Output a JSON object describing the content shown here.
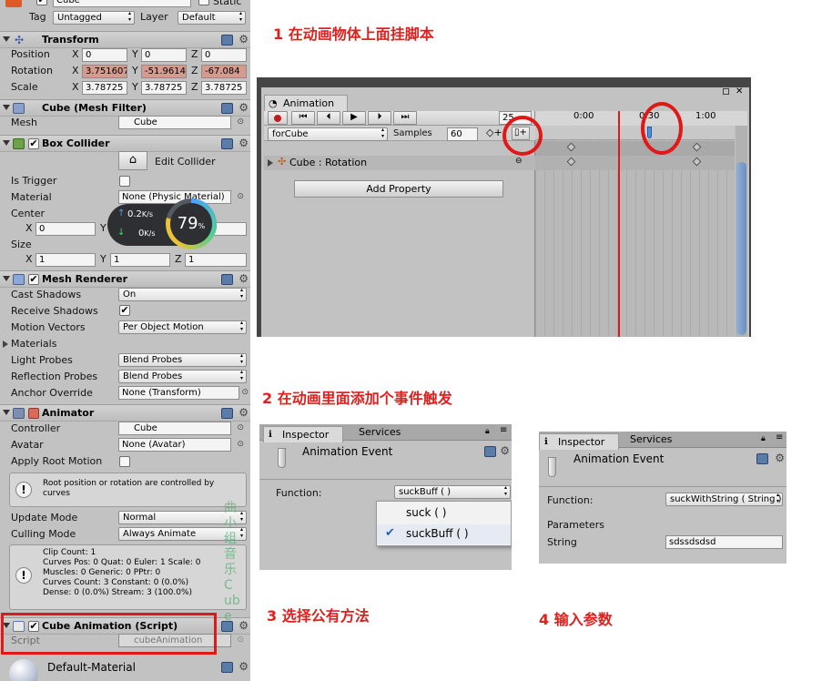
{
  "inspector": {
    "object_name": "Cube",
    "static_label": "Static",
    "tag_label": "Tag",
    "tag_value": "Untagged",
    "layer_label": "Layer",
    "layer_value": "Default",
    "transform": {
      "title": "Transform",
      "position_label": "Position",
      "rotation_label": "Rotation",
      "scale_label": "Scale",
      "position": [
        "0",
        "0",
        "0"
      ],
      "rotation": [
        "3.751607",
        "-51.9614",
        "-67.084"
      ],
      "scale": [
        "3.78725",
        "3.78725",
        "3.78725"
      ]
    },
    "mesh_filter": {
      "title": "Cube (Mesh Filter)",
      "mesh_label": "Mesh",
      "mesh_value": "Cube"
    },
    "box_collider": {
      "title": "Box Collider",
      "edit_label": "Edit Collider",
      "is_trigger_label": "Is Trigger",
      "material_label": "Material",
      "material_value": "None (Physic Material)",
      "center_label": "Center",
      "center": [
        "0",
        "0",
        "0"
      ],
      "size_label": "Size",
      "size": [
        "1",
        "1",
        "1"
      ]
    },
    "net_widget": {
      "up": "0.2",
      "up_unit": "K/s",
      "down": "0",
      "down_unit": "K/s",
      "percent": "79",
      "percent_sign": "%"
    },
    "mesh_renderer": {
      "title": "Mesh Renderer",
      "rows": [
        {
          "label": "Cast Shadows",
          "value": "On"
        },
        {
          "label": "Receive Shadows",
          "value": "✔"
        },
        {
          "label": "Motion Vectors",
          "value": "Per Object Motion"
        },
        {
          "label": "Materials",
          "value": ""
        },
        {
          "label": "Light Probes",
          "value": "Blend Probes"
        },
        {
          "label": "Reflection Probes",
          "value": "Blend Probes"
        },
        {
          "label": "Anchor Override",
          "value": "None (Transform)"
        }
      ]
    },
    "animator": {
      "title": "Animator",
      "controller_label": "Controller",
      "controller_value": "Cube",
      "avatar_label": "Avatar",
      "avatar_value": "None (Avatar)",
      "apply_root_label": "Apply Root Motion",
      "info": "Root position or rotation are controlled by curves",
      "update_label": "Update Mode",
      "update_value": "Normal",
      "culling_label": "Culling Mode",
      "culling_value": "Always Animate",
      "clip_info": [
        "Clip Count: 1",
        "Curves Pos: 0 Quat: 0 Euler: 1 Scale: 0",
        "Muscles: 0 Generic: 0 PPtr: 0",
        "Curves Count: 3 Constant: 0 (0.0%)",
        "Dense: 0 (0.0%) Stream: 3 (100.0%)"
      ]
    },
    "script_comp": {
      "title": "Cube Animation (Script)",
      "script_label": "Script",
      "script_value": "cubeAnimation"
    },
    "material": {
      "title": "Default-Material"
    },
    "watermark": "曲 小组音乐 Cube"
  },
  "steps": {
    "s1": "1 在动画物体上面挂脚本",
    "s2": "2 在动画里面添加个事件触发",
    "s3": "3 选择公有方法",
    "s4": "4 输入参数"
  },
  "animation": {
    "tab": "Animation",
    "frame": "25",
    "clip": "forCube",
    "samples_label": "Samples",
    "samples_value": "60",
    "times": [
      "0:00",
      "0:30",
      "1:00"
    ],
    "property": "Cube : Rotation",
    "add_property": "Add Property"
  },
  "event1": {
    "tab_inspector": "Inspector",
    "tab_services": "Services",
    "title": "Animation Event",
    "function_label": "Function:",
    "function_value": "suckBuff ( )",
    "options": [
      "suck ( )",
      "suckBuff ( )"
    ],
    "check": "✔"
  },
  "event2": {
    "tab_inspector": "Inspector",
    "tab_services": "Services",
    "title": "Animation Event",
    "function_label": "Function:",
    "function_value": "suckWithString ( String )",
    "parameters_label": "Parameters",
    "string_label": "String",
    "string_value": "sdssdsdsd"
  },
  "colors": {
    "accent_red": "#e0201e",
    "playhead": "#e01818",
    "event_marker": "#4a90e2"
  }
}
